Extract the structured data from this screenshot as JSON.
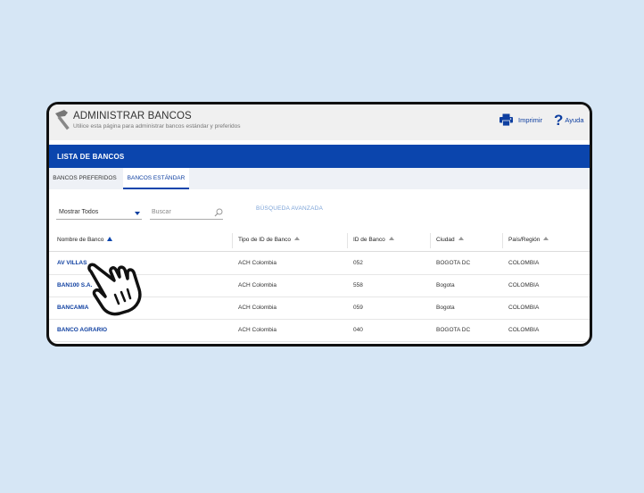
{
  "header": {
    "title": "ADMINISTRAR BANCOS",
    "subtitle": "Utilice esta página para administrar bancos estándar y preferidos",
    "print_label": "Imprimir",
    "help_label": "Ayuda"
  },
  "bluebar": {
    "title": "LISTA DE BANCOS"
  },
  "tabs": [
    {
      "label": "BANCOS PREFERIDOS"
    },
    {
      "label": "BANCOS ESTÁNDAR"
    }
  ],
  "toolbar": {
    "filter_value": "Mostrar Todos",
    "search_placeholder": "Buscar",
    "advanced_search": "BÚSQUEDA AVANZADA"
  },
  "table": {
    "columns": [
      "Nombre de Banco",
      "Tipo de ID de Banco",
      "ID de Banco",
      "Ciudad",
      "País/Región"
    ],
    "rows": [
      [
        "AV VILLAS",
        "ACH Colombia",
        "052",
        "BOGOTA DC",
        "COLOMBIA"
      ],
      [
        "BAN100 S.A.",
        "ACH Colombia",
        "558",
        "Bogota",
        "COLOMBIA"
      ],
      [
        "BANCAMIA",
        "ACH Colombia",
        "059",
        "Bogota",
        "COLOMBIA"
      ],
      [
        "BANCO AGRARIO",
        "ACH Colombia",
        "040",
        "BOGOTA DC",
        "COLOMBIA"
      ]
    ]
  },
  "colors": {
    "brand_blue": "#0b45ad",
    "link_blue": "#0e3fa0",
    "background": "#d6e6f5"
  }
}
